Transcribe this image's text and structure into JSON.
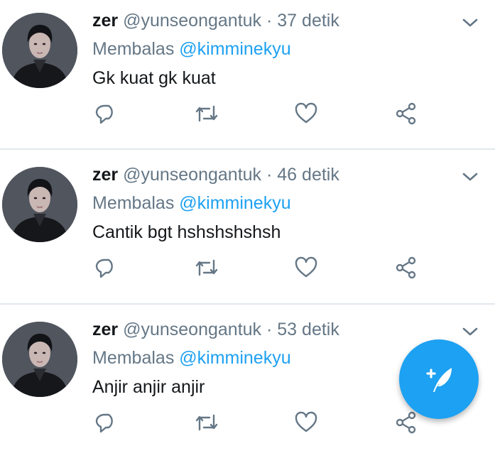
{
  "tweets": [
    {
      "name": "zer",
      "handle": "@yunseongantuk",
      "separator": " · ",
      "time": "37 detik",
      "replying_label": "Membalas ",
      "replying_to": "@kimminekyu",
      "text": "Gk kuat gk kuat"
    },
    {
      "name": "zer",
      "handle": "@yunseongantuk",
      "separator": " · ",
      "time": "46 detik",
      "replying_label": "Membalas ",
      "replying_to": "@kimminekyu",
      "text": "Cantik bgt hshshshshsh"
    },
    {
      "name": "zer",
      "handle": "@yunseongantuk",
      "separator": " · ",
      "time": "53 detik",
      "replying_label": "Membalas ",
      "replying_to": "@kimminekyu",
      "text": "Anjir anjir anjir"
    }
  ],
  "icons": {
    "reply": "reply-icon",
    "retweet": "retweet-icon",
    "like": "heart-icon",
    "share": "share-icon",
    "more": "chevron-down-icon",
    "compose": "compose-tweet-icon"
  },
  "colors": {
    "accent": "#1da1f2",
    "icon_gray": "#657786",
    "divider": "#e1e8ed"
  }
}
